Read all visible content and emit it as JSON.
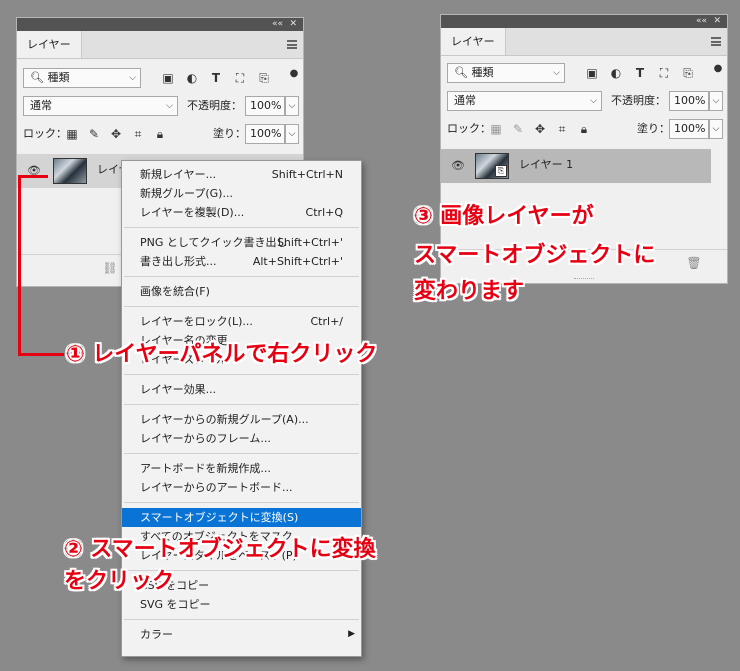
{
  "left_panel": {
    "collapse": "««",
    "close": "✕",
    "tab": "レイヤー",
    "filter_value": "種類",
    "blend_mode": "通常",
    "opacity_label": "不透明度：",
    "opacity_value": "100%",
    "lock_label": "ロック：",
    "fill_label": "塗り：",
    "fill_value": "100%",
    "layer_name": "レイヤー"
  },
  "right_panel": {
    "collapse": "««",
    "close": "✕",
    "tab": "レイヤー",
    "filter_value": "種類",
    "blend_mode": "通常",
    "opacity_label": "不透明度：",
    "opacity_value": "100%",
    "lock_label": "ロック：",
    "fill_label": "塗り：",
    "fill_value": "100%",
    "layer_name": "レイヤー 1"
  },
  "context_menu": {
    "groups": [
      [
        {
          "label": "新規レイヤー...",
          "shortcut": "Shift+Ctrl+N"
        },
        {
          "label": "新規グループ(G)...",
          "shortcut": ""
        },
        {
          "label": "レイヤーを複製(D)...",
          "shortcut": "Ctrl+Q"
        }
      ],
      [
        {
          "label": "PNG としてクイック書き出し",
          "shortcut": "Shift+Ctrl+'"
        },
        {
          "label": "書き出し形式...",
          "shortcut": "Alt+Shift+Ctrl+'"
        }
      ],
      [
        {
          "label": "画像を統合(F)",
          "shortcut": ""
        }
      ],
      [
        {
          "label": "レイヤーをロック(L)...",
          "shortcut": "Ctrl+/"
        },
        {
          "label": "レイヤー名の変更...",
          "shortcut": ""
        },
        {
          "label": "レイヤースタイル",
          "shortcut": ""
        }
      ],
      [
        {
          "label": "レイヤー効果...",
          "shortcut": ""
        }
      ],
      [
        {
          "label": "レイヤーからの新規グループ(A)...",
          "shortcut": ""
        },
        {
          "label": "レイヤーからのフレーム...",
          "shortcut": ""
        }
      ],
      [
        {
          "label": "アートボードを新規作成...",
          "shortcut": ""
        },
        {
          "label": "レイヤーからのアートボード...",
          "shortcut": ""
        }
      ],
      [
        {
          "label": "スマートオブジェクトに変換(S)",
          "shortcut": "",
          "highlighted": true
        },
        {
          "label": "すべてのオブジェクトをマスク",
          "shortcut": ""
        },
        {
          "label": "レイヤースタイルをペースト(P)",
          "shortcut": ""
        }
      ],
      [
        {
          "label": "CSS をコピー",
          "shortcut": ""
        },
        {
          "label": "SVG をコピー",
          "shortcut": ""
        }
      ],
      [
        {
          "label": "カラー",
          "shortcut": "",
          "submenu": true
        }
      ]
    ]
  },
  "annotations": {
    "step1": "① レイヤーパネルで右クリック",
    "step2_line1": "② スマートオブジェクトに変換",
    "step2_line2": "をクリック",
    "step3_line1": "③ 画像レイヤーが",
    "step3_line2": "スマートオブジェクトに",
    "step3_line3": "変わります"
  },
  "colors": {
    "background": "#8a8a8a",
    "panel": "#f0f0f0",
    "highlight": "#0a74d6",
    "annotation": "#e60012"
  }
}
